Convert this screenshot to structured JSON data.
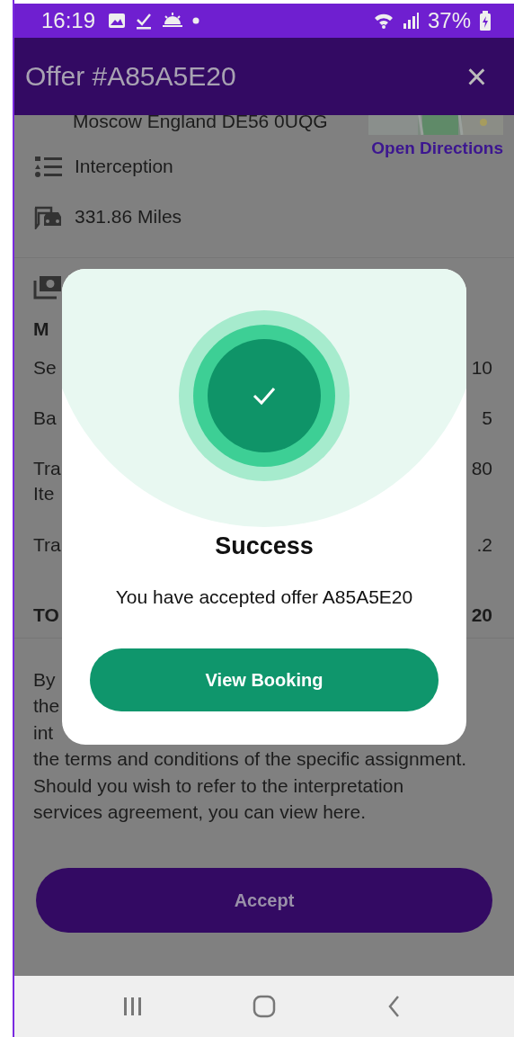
{
  "status_bar": {
    "time": "16:19",
    "battery": "37%"
  },
  "app_bar": {
    "title": "Offer #A85A5E20",
    "close": "×"
  },
  "location": {
    "address": "Moscow England DE56 0UQG",
    "directions_link": "Open Directions"
  },
  "details": [
    {
      "kind": "list",
      "text": "Interception"
    },
    {
      "kind": "car",
      "text": "331.86 Miles"
    }
  ],
  "payment": {
    "heading": "M",
    "rows": [
      {
        "label_lines": [
          "Se"
        ],
        "value": "10"
      },
      {
        "label_lines": [
          "Ba"
        ],
        "value": "5"
      },
      {
        "label_lines": [
          "Tra",
          "Ite"
        ],
        "value": "80"
      },
      {
        "label_lines": [
          "Tra"
        ],
        "value": ".2"
      }
    ],
    "total": {
      "label": "TO",
      "value": "20"
    }
  },
  "terms": {
    "covered_lines": [
      "By",
      "the",
      "int"
    ],
    "text": "the terms and conditions of the specific assignment. Should you wish to refer to the interpretation services agreement, you can view here."
  },
  "accept_button": "Accept",
  "dialog": {
    "title": "Success",
    "message": "You have accepted offer A85A5E20",
    "button": "View Booking"
  }
}
